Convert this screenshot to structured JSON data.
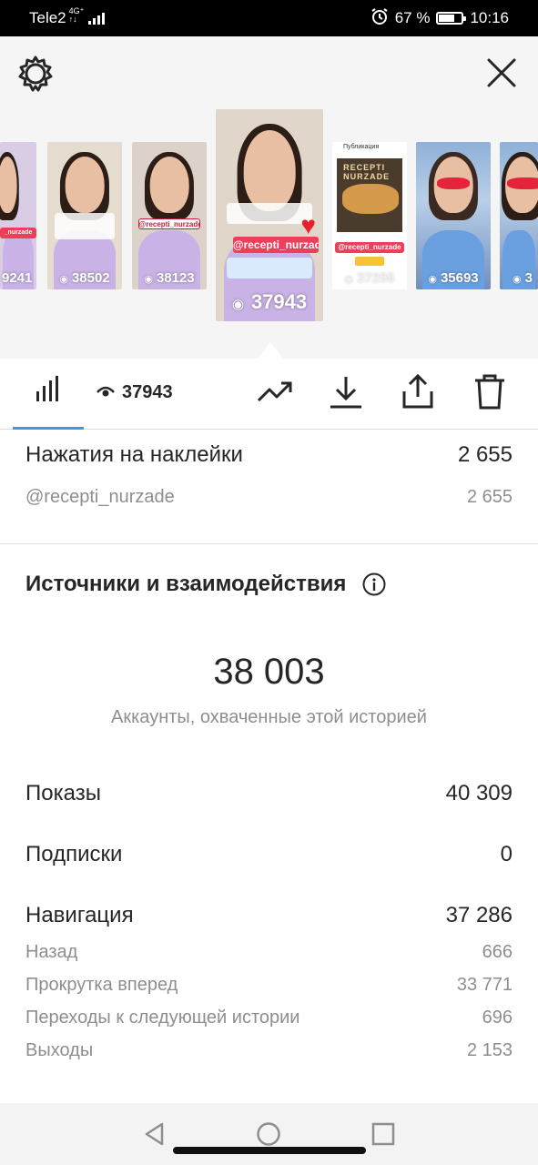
{
  "status_bar": {
    "carrier": "Tele2",
    "network_top": "4G⁺",
    "network_bottom": "↑↓",
    "battery": "67 %",
    "time": "10:16",
    "battery_level": 0.67
  },
  "stories": [
    {
      "views": "9241",
      "tag": "_nurzade"
    },
    {
      "views": "38502"
    },
    {
      "views": "38123",
      "tag": "@recepti_nurzade"
    },
    {
      "views": "37943",
      "tag": "@recepti_nurzade",
      "selected": true
    },
    {
      "views": "37255",
      "header": "Публикация",
      "tag": "@recepti_nurzade",
      "label": "RECEPTI NURZADE"
    },
    {
      "views": "35693"
    },
    {
      "views": "3"
    }
  ],
  "tabs": {
    "views_count": "37943"
  },
  "sticker_taps": {
    "label": "Нажатия на наклейки",
    "value": "2 655",
    "items": [
      {
        "label": "@recepti_nurzade",
        "value": "2 655"
      }
    ]
  },
  "interactions": {
    "title": "Источники и взаимодействия",
    "reach_value": "38 003",
    "reach_caption": "Аккаунты, охваченные этой историей",
    "impressions": {
      "label": "Показы",
      "value": "40 309"
    },
    "follows": {
      "label": "Подписки",
      "value": "0"
    },
    "navigation": {
      "label": "Навигация",
      "value": "37 286",
      "items": [
        {
          "label": "Назад",
          "value": "666"
        },
        {
          "label": "Прокрутка вперед",
          "value": "33 771"
        },
        {
          "label": "Переходы к следующей истории",
          "value": "696"
        },
        {
          "label": "Выходы",
          "value": "2 153"
        }
      ]
    }
  },
  "colors": {
    "accent": "#3897f0",
    "story_tag": "#ef3e5a",
    "text_primary": "#262626",
    "text_secondary": "#8e8e8e"
  }
}
